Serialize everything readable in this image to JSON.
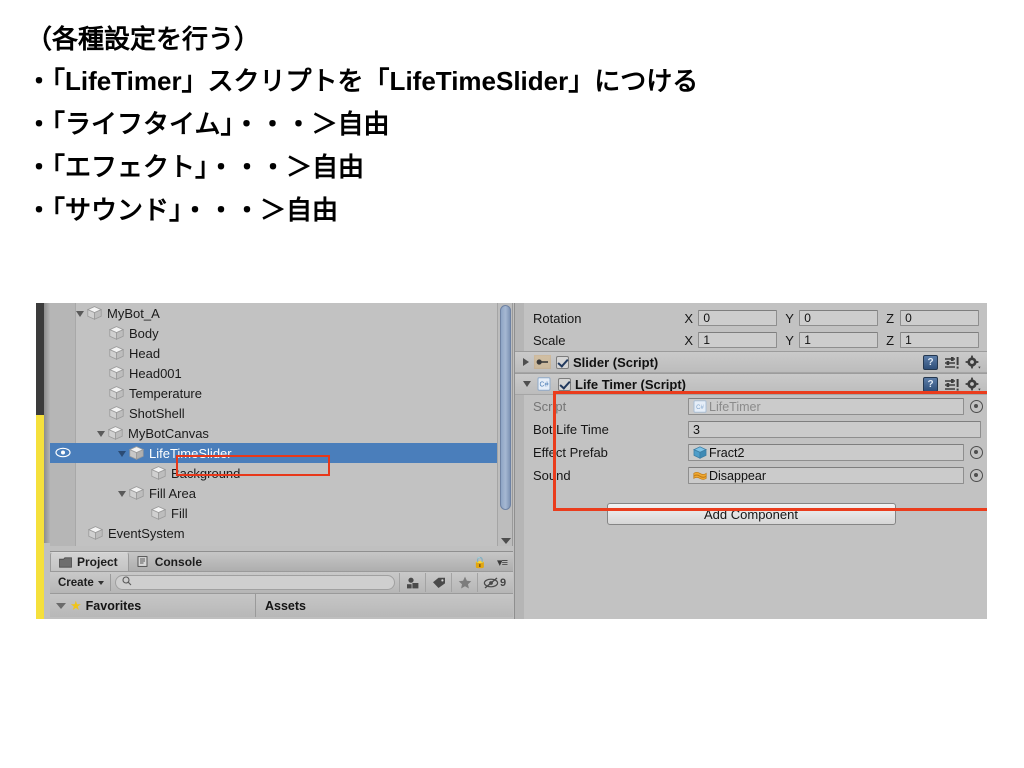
{
  "slide": {
    "lines": [
      "（各種設定を行う）",
      "・「LifeTimer」スクリプトを「LifeTimeSlider」につける",
      "・「ライフタイム」・・・＞自由",
      "・「エフェクト」・・・＞自由",
      "・「サウンド」・・・＞自由"
    ]
  },
  "hierarchy": {
    "items": [
      {
        "label": "MyBot_A",
        "indent": 1,
        "arrow": "down",
        "selected": false
      },
      {
        "label": "Body",
        "indent": 2,
        "arrow": "none",
        "selected": false
      },
      {
        "label": "Head",
        "indent": 2,
        "arrow": "none",
        "selected": false
      },
      {
        "label": "Head001",
        "indent": 2,
        "arrow": "none",
        "selected": false
      },
      {
        "label": "Temperature",
        "indent": 2,
        "arrow": "none",
        "selected": false
      },
      {
        "label": "ShotShell",
        "indent": 2,
        "arrow": "none",
        "selected": false
      },
      {
        "label": "MyBotCanvas",
        "indent": 2,
        "arrow": "down",
        "selected": false
      },
      {
        "label": "LifeTimeSlider",
        "indent": 3,
        "arrow": "down",
        "selected": true
      },
      {
        "label": "Background",
        "indent": 4,
        "arrow": "none",
        "selected": false
      },
      {
        "label": "Fill Area",
        "indent": 3,
        "arrow": "down",
        "selected": false
      },
      {
        "label": "Fill",
        "indent": 4,
        "arrow": "none",
        "selected": false
      },
      {
        "label": "EventSystem",
        "indent": 1,
        "arrow": "none",
        "selected": false
      }
    ],
    "selection_highlight_color": "#4a7ebb",
    "annotation_color": "#e8381a"
  },
  "project_panel": {
    "tabs": [
      {
        "label": "Project",
        "active": true
      },
      {
        "label": "Console",
        "active": false
      }
    ],
    "create_button": "Create",
    "search_placeholder": "",
    "hidden_count": "9",
    "columns": {
      "favorites": "Favorites",
      "assets": "Assets"
    }
  },
  "inspector": {
    "transform": [
      {
        "label": "Rotation",
        "x": "0",
        "y": "0",
        "z": "0"
      },
      {
        "label": "Scale",
        "x": "1",
        "y": "1",
        "z": "1"
      }
    ],
    "axis_labels": {
      "x": "X",
      "y": "Y",
      "z": "Z"
    },
    "components": [
      {
        "title": "Slider (Script)",
        "expanded": false,
        "enabled": true,
        "icon": "slider-component-icon"
      },
      {
        "title": "Life Timer (Script)",
        "expanded": true,
        "enabled": true,
        "icon": "csharp-script-icon",
        "highlighted": true,
        "properties": [
          {
            "label": "Script",
            "value": "LifeTimer",
            "kind": "script",
            "readonly": true,
            "has_picker": true
          },
          {
            "label": "Bot Life Time",
            "value": "3",
            "kind": "number",
            "readonly": false,
            "has_picker": false
          },
          {
            "label": "Effect Prefab",
            "value": "Fract2",
            "kind": "prefab",
            "readonly": false,
            "has_picker": true
          },
          {
            "label": "Sound",
            "value": "Disappear",
            "kind": "audio",
            "readonly": false,
            "has_picker": true
          }
        ]
      }
    ],
    "add_component_button": "Add Component",
    "annotation_color": "#ea3c1c"
  }
}
